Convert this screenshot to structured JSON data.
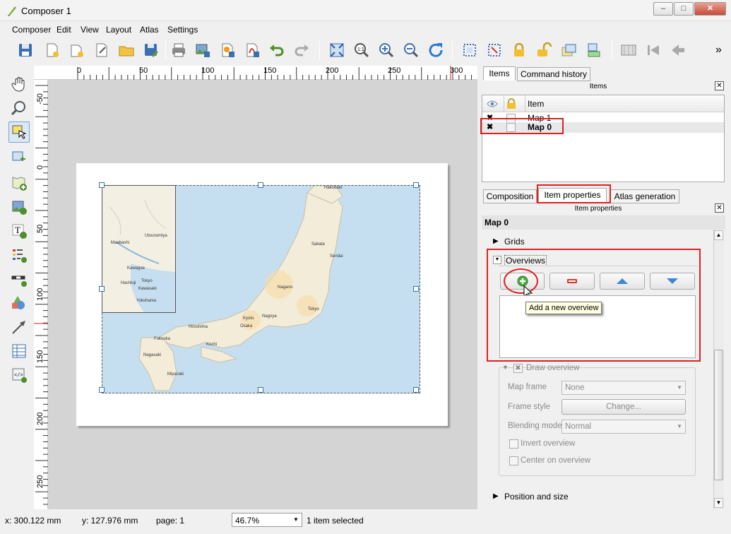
{
  "window": {
    "title": "Composer 1",
    "minimize": "–",
    "maximize": "□",
    "close": "✕"
  },
  "menu": [
    "Composer",
    "Edit",
    "View",
    "Layout",
    "Atlas",
    "Settings"
  ],
  "toolbar": {
    "more": "»"
  },
  "ruler_h": [
    "0",
    "50",
    "100",
    "150",
    "200",
    "250",
    "300"
  ],
  "ruler_v": [
    "-50",
    "0",
    "50",
    "100",
    "150",
    "200",
    "250"
  ],
  "map_cities": {
    "hakodate": "Hakodate",
    "sakata": "Sakata",
    "sendai": "Sendai",
    "niigata": "Niigata",
    "nagano": "Nagano",
    "tokyo": "Tokyo",
    "nagoya": "Nagoya",
    "kyoto": "Kyoto",
    "osaka": "Osaka",
    "hiroshima": "Hiroshima",
    "kochi": "Kochi",
    "fukuoka": "Fukuoka",
    "nagasaki": "Nagasaki",
    "miyazaki": "Miyazaki"
  },
  "overview_cities": {
    "a": "Utsunomiya",
    "b": "Maebashi",
    "c": "Kawagoe",
    "d": "Hachioji",
    "e": "Tokyo",
    "f": "Kawasaki",
    "g": "Yokohama"
  },
  "tabs_top": {
    "items": "Items",
    "history": "Command history"
  },
  "items_dock": {
    "title": "Items",
    "col_item": "Item",
    "rows": [
      {
        "name": "Map 1",
        "bold": false
      },
      {
        "name": "Map 0",
        "bold": true
      }
    ]
  },
  "tabs_mid": {
    "composition": "Composition",
    "item_props": "Item properties",
    "atlas": "Atlas generation"
  },
  "props_dock": {
    "title": "Item properties",
    "header": "Map 0"
  },
  "sections": {
    "grids": "Grids",
    "overviews": "Overviews",
    "position": "Position and size"
  },
  "tooltip": "Add a new overview",
  "draw_overview": {
    "title": "Draw overview",
    "map_frame_label": "Map frame",
    "map_frame_value": "None",
    "frame_style_label": "Frame style",
    "frame_style_button": "Change...",
    "blending_label": "Blending mode",
    "blending_value": "Normal",
    "invert": "Invert overview",
    "center": "Center on overview"
  },
  "status": {
    "x": "x: 300.122 mm",
    "y": "y: 127.976 mm",
    "page": "page: 1",
    "zoom": "46.7%",
    "selected": "1 item selected"
  },
  "colors": {
    "accent_red": "#e02020",
    "sea": "#c6dff0",
    "land": "#f3efe3"
  }
}
